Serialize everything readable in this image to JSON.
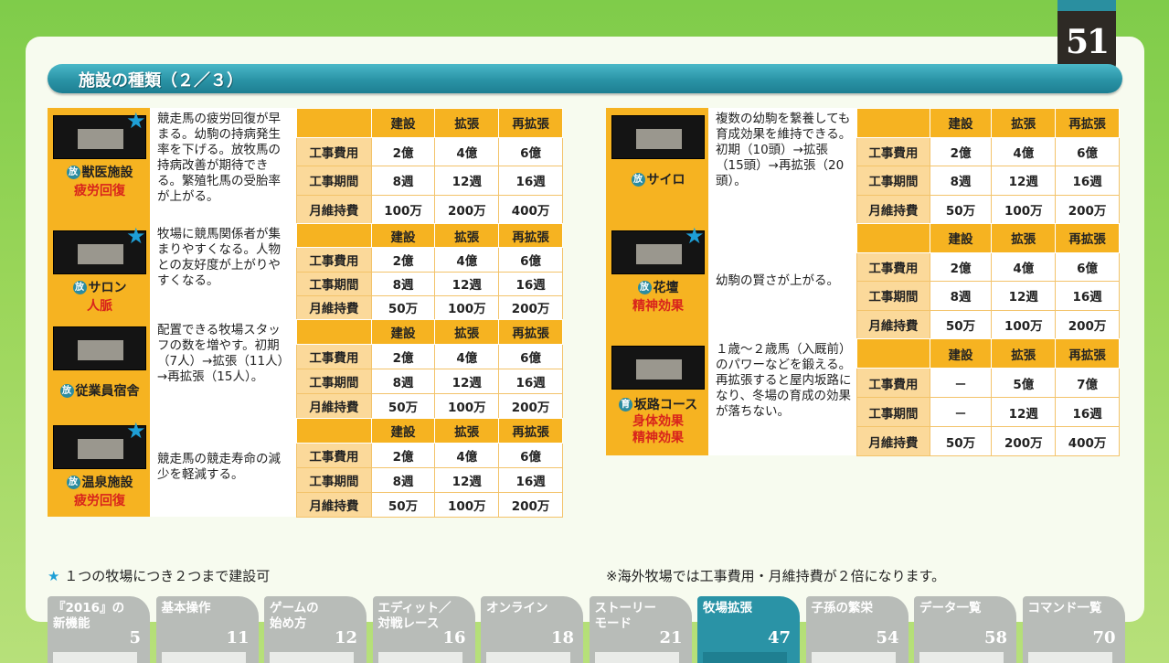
{
  "page_number": "51",
  "title": "施設の種類（２／３）",
  "table_headers": [
    "建設",
    "拡張",
    "再拡張"
  ],
  "row_labels": [
    "工事費用",
    "工事期間",
    "月維持費"
  ],
  "left_facilities": [
    {
      "badge": "放",
      "name": "獣医施設",
      "effects": [
        "疲労回復"
      ],
      "star": true,
      "desc": "競走馬の疲労回復が早まる。幼駒の持病発生率を下げる。放牧馬の持病改善が期待できる。繁殖牝馬の受胎率が上がる。",
      "rows": [
        [
          "2億",
          "4億",
          "6億"
        ],
        [
          "8週",
          "12週",
          "16週"
        ],
        [
          "100万",
          "200万",
          "400万"
        ]
      ]
    },
    {
      "badge": "放",
      "name": "サロン",
      "effects": [
        "人脈"
      ],
      "star": true,
      "desc": "牧場に競馬関係者が集まりやすくなる。人物との友好度が上がりやすくなる。",
      "rows": [
        [
          "2億",
          "4億",
          "6億"
        ],
        [
          "8週",
          "12週",
          "16週"
        ],
        [
          "50万",
          "100万",
          "200万"
        ]
      ]
    },
    {
      "badge": "放",
      "name": "従業員宿舎",
      "effects": [],
      "star": false,
      "desc": "配置できる牧場スタッフの数を増やす。初期（7人）→拡張（11人）→再拡張（15人）。",
      "rows": [
        [
          "2億",
          "4億",
          "6億"
        ],
        [
          "8週",
          "12週",
          "16週"
        ],
        [
          "50万",
          "100万",
          "200万"
        ]
      ]
    },
    {
      "badge": "放",
      "name": "温泉施設",
      "effects": [
        "疲労回復"
      ],
      "star": true,
      "desc": "競走馬の競走寿命の減少を軽減する。",
      "rows": [
        [
          "2億",
          "4億",
          "6億"
        ],
        [
          "8週",
          "12週",
          "16週"
        ],
        [
          "50万",
          "100万",
          "200万"
        ]
      ]
    }
  ],
  "right_facilities": [
    {
      "badge": "放",
      "name": "サイロ",
      "effects": [],
      "star": false,
      "desc": "複数の幼駒を繋養しても育成効果を維持できる。初期（10頭）→拡張（15頭）→再拡張（20頭）。",
      "rows": [
        [
          "2億",
          "4億",
          "6億"
        ],
        [
          "8週",
          "12週",
          "16週"
        ],
        [
          "50万",
          "100万",
          "200万"
        ]
      ]
    },
    {
      "badge": "放",
      "name": "花壇",
      "effects": [
        "精神効果"
      ],
      "star": true,
      "desc": "幼駒の賢さが上がる。",
      "rows": [
        [
          "2億",
          "4億",
          "6億"
        ],
        [
          "8週",
          "12週",
          "16週"
        ],
        [
          "50万",
          "100万",
          "200万"
        ]
      ]
    },
    {
      "badge": "育",
      "name": "坂路コース",
      "effects": [
        "身体効果",
        "精神効果"
      ],
      "star": false,
      "desc": "１歳～２歳馬（入厩前）のパワーなどを鍛える。再拡張すると屋内坂路になり、冬場の育成の効果が落ちない。",
      "rows": [
        [
          "－",
          "5億",
          "7億"
        ],
        [
          "－",
          "12週",
          "16週"
        ],
        [
          "50万",
          "200万",
          "400万"
        ]
      ]
    }
  ],
  "footnote_star_mark": "★",
  "footnote_star": "１つの牧場につき２つまで建設可",
  "footnote_overseas": "※海外牧場では工事費用・月維持費が２倍になります。",
  "nav_tabs": [
    {
      "label": "『2016』の\n新機能",
      "page": "5",
      "active": false
    },
    {
      "label": "基本操作",
      "page": "11",
      "active": false
    },
    {
      "label": "ゲームの\n始め方",
      "page": "12",
      "active": false
    },
    {
      "label": "エディット／\n対戦レース",
      "page": "16",
      "active": false
    },
    {
      "label": "オンライン",
      "page": "18",
      "active": false
    },
    {
      "label": "ストーリー\nモード",
      "page": "21",
      "active": false
    },
    {
      "label": "牧場拡張",
      "page": "47",
      "active": true
    },
    {
      "label": "子孫の繁栄",
      "page": "54",
      "active": false
    },
    {
      "label": "データ一覧",
      "page": "58",
      "active": false
    },
    {
      "label": "コマンド一覧",
      "page": "70",
      "active": false
    }
  ]
}
